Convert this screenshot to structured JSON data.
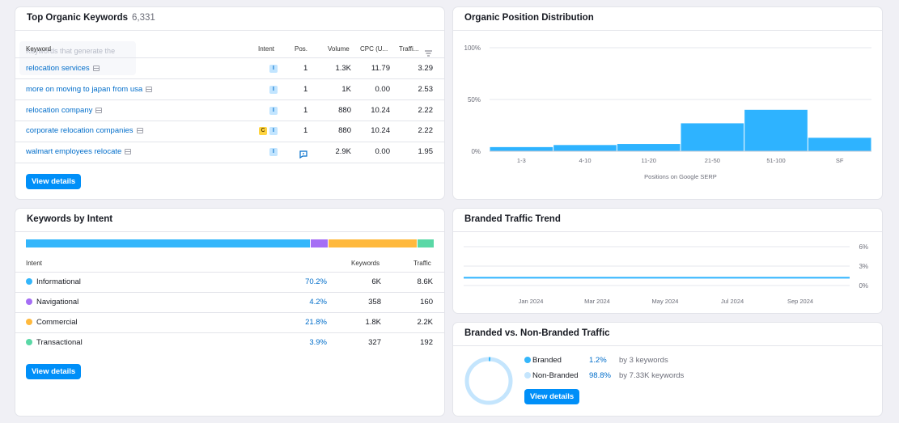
{
  "top_keywords": {
    "title": "Top Organic Keywords",
    "count": "6,331",
    "ghost_text": "Keywords that generate the",
    "headers": {
      "keyword": "Keyword",
      "intent": "Intent",
      "pos": "Pos.",
      "volume": "Volume",
      "cpc": "CPC (U...",
      "traffic": "Traffi..."
    },
    "rows": [
      {
        "keyword": "relocation services",
        "intent": [
          "I"
        ],
        "pos": "1",
        "volume": "1.3K",
        "cpc": "11.79",
        "traffic": "3.29"
      },
      {
        "keyword": "more on moving to japan from usa",
        "intent": [
          "I"
        ],
        "pos": "1",
        "volume": "1K",
        "cpc": "0.00",
        "traffic": "2.53"
      },
      {
        "keyword": "relocation company",
        "intent": [
          "I"
        ],
        "pos": "1",
        "volume": "880",
        "cpc": "10.24",
        "traffic": "2.22"
      },
      {
        "keyword": "corporate relocation companies",
        "intent": [
          "C",
          "I"
        ],
        "pos": "1",
        "volume": "880",
        "cpc": "10.24",
        "traffic": "2.22"
      },
      {
        "keyword": "walmart employees relocate",
        "intent": [
          "I"
        ],
        "pos": "serp-feature-icon",
        "volume": "2.9K",
        "cpc": "0.00",
        "traffic": "1.95"
      }
    ],
    "button": "View details"
  },
  "position_dist": {
    "title": "Organic Position Distribution",
    "chart_data": {
      "type": "bar",
      "categories": [
        "1-3",
        "4-10",
        "11-20",
        "21-50",
        "51-100",
        "SF"
      ],
      "values": [
        4,
        6,
        7,
        27,
        40,
        13
      ],
      "ylim": [
        0,
        100
      ],
      "yticks": [
        "100%",
        "50%",
        "0%"
      ],
      "xlabel": "Positions on Google SERP",
      "color": "#2eb3ff"
    }
  },
  "intent": {
    "title": "Keywords by Intent",
    "bar": [
      {
        "share": 70.2,
        "color": "#34b6fb"
      },
      {
        "share": 4.2,
        "color": "#a56ef5"
      },
      {
        "share": 21.8,
        "color": "#ffb93d"
      },
      {
        "share": 3.9,
        "color": "#5ad8a6"
      }
    ],
    "headers": {
      "intent": "Intent",
      "keywords": "Keywords",
      "traffic": "Traffic"
    },
    "rows": [
      {
        "name": "Informational",
        "pct": "70.2%",
        "keywords": "6K",
        "traffic": "8.6K",
        "color": "#34b6fb"
      },
      {
        "name": "Navigational",
        "pct": "4.2%",
        "keywords": "358",
        "traffic": "160",
        "color": "#a56ef5"
      },
      {
        "name": "Commercial",
        "pct": "21.8%",
        "keywords": "1.8K",
        "traffic": "2.2K",
        "color": "#ffb93d"
      },
      {
        "name": "Transactional",
        "pct": "3.9%",
        "keywords": "327",
        "traffic": "192",
        "color": "#5ad8a6"
      }
    ],
    "button": "View details"
  },
  "branded_trend": {
    "title": "Branded Traffic Trend",
    "chart_data": {
      "type": "line",
      "yticks": [
        "6%",
        "3%",
        "0%"
      ],
      "ylim": [
        0,
        6
      ],
      "x": [
        "Jan 2024",
        "Mar 2024",
        "May 2024",
        "Jul 2024",
        "Sep 2024"
      ],
      "values": [
        1.2,
        1.2,
        1.2,
        1.2,
        1.2
      ],
      "color": "#2eb3ff"
    }
  },
  "branded_vs": {
    "title": "Branded vs. Non-Branded Traffic",
    "items": [
      {
        "label": "Branded",
        "pct": "1.2%",
        "detail": "by 3 keywords",
        "color": "#34b6fb"
      },
      {
        "label": "Non-Branded",
        "pct": "98.8%",
        "detail": "by 7.33K keywords",
        "color": "#c4e5fd"
      }
    ],
    "button": "View details",
    "chart_data": {
      "type": "pie",
      "categories": [
        "Branded",
        "Non-Branded"
      ],
      "values": [
        1.2,
        98.8
      ]
    }
  }
}
